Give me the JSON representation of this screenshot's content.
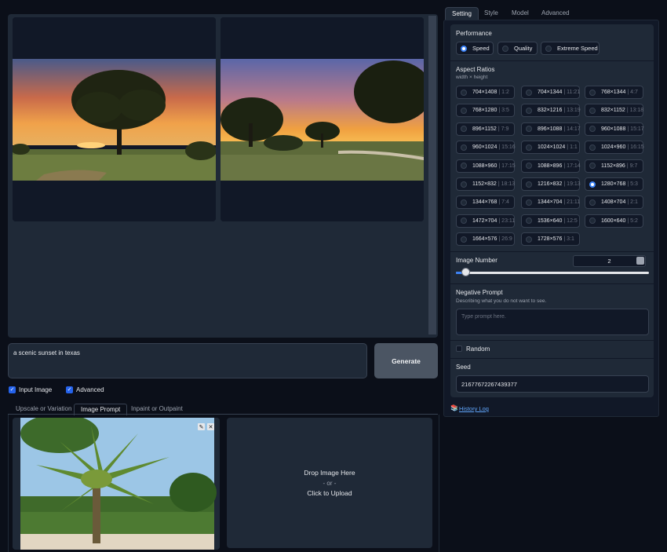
{
  "gallery": {
    "images": [
      "sunset-oak-tree",
      "sunset-field-trees"
    ]
  },
  "prompt": {
    "value": "a scenic sunset in texas"
  },
  "generate_label": "Generate",
  "checks": {
    "input_image": "Input Image",
    "advanced": "Advanced"
  },
  "input_tabs": [
    "Upscale or Variation",
    "Image Prompt",
    "Inpaint or Outpaint"
  ],
  "drop": {
    "line1": "Drop Image Here",
    "line2": "- or -",
    "line3": "Click to Upload"
  },
  "right_tabs": [
    "Setting",
    "Style",
    "Model",
    "Advanced"
  ],
  "performance": {
    "title": "Performance",
    "options": [
      "Speed",
      "Quality",
      "Extreme Speed"
    ],
    "selected": "Speed"
  },
  "aspect": {
    "title": "Aspect Ratios",
    "subtitle": "width × height",
    "options": [
      [
        "704×1408",
        "1:2"
      ],
      [
        "704×1344",
        "11:21"
      ],
      [
        "768×1344",
        "4:7"
      ],
      [
        "768×1280",
        "3:5"
      ],
      [
        "832×1216",
        "13:19"
      ],
      [
        "832×1152",
        "13:18"
      ],
      [
        "896×1152",
        "7:9"
      ],
      [
        "896×1088",
        "14:17"
      ],
      [
        "960×1088",
        "15:17"
      ],
      [
        "960×1024",
        "15:16"
      ],
      [
        "1024×1024",
        "1:1"
      ],
      [
        "1024×960",
        "16:15"
      ],
      [
        "1088×960",
        "17:15"
      ],
      [
        "1088×896",
        "17:14"
      ],
      [
        "1152×896",
        "9:7"
      ],
      [
        "1152×832",
        "18:13"
      ],
      [
        "1216×832",
        "19:13"
      ],
      [
        "1280×768",
        "5:3"
      ],
      [
        "1344×768",
        "7:4"
      ],
      [
        "1344×704",
        "21:11"
      ],
      [
        "1408×704",
        "2:1"
      ],
      [
        "1472×704",
        "23:11"
      ],
      [
        "1536×640",
        "12:5"
      ],
      [
        "1600×640",
        "5:2"
      ],
      [
        "1664×576",
        "26:9"
      ],
      [
        "1728×576",
        "3:1"
      ]
    ],
    "selected": "1280×768"
  },
  "image_number": {
    "label": "Image Number",
    "value": "2"
  },
  "negative": {
    "title": "Negative Prompt",
    "subtitle": "Describing what you do not want to see.",
    "placeholder": "Type prompt here."
  },
  "random_label": "Random",
  "seed": {
    "label": "Seed",
    "value": "2167767226743937​7"
  },
  "history_label": "History Log",
  "colors": {
    "accent": "#3b82f6",
    "bg": "#0b0f19",
    "panel": "#1f2937"
  }
}
